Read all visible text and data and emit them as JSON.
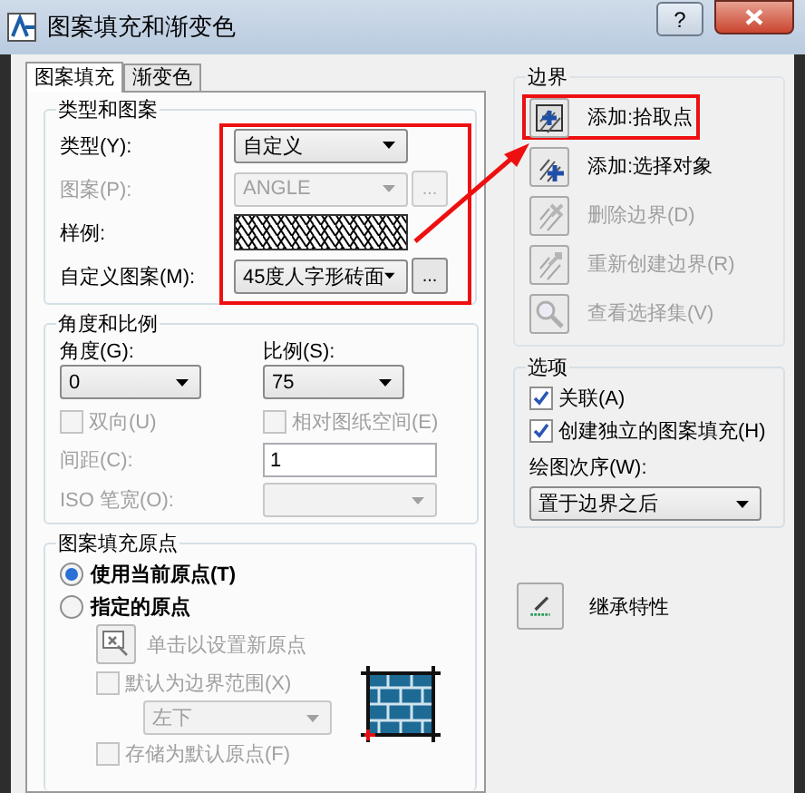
{
  "window": {
    "title": "图案填充和渐变色",
    "help": "?"
  },
  "tabs": [
    {
      "label": "图案填充",
      "selected": true
    },
    {
      "label": "渐变色",
      "selected": false
    }
  ],
  "type_and_pattern": {
    "title": "类型和图案",
    "highlighted": true,
    "fields": [
      {
        "kind": "dropdown",
        "label": "类型(Y):",
        "value": "自定义",
        "disabled": false
      },
      {
        "kind": "dropdown_browse",
        "label": "图案(P):",
        "value": "ANGLE",
        "browse": "...",
        "disabled": true
      },
      {
        "kind": "swatch",
        "label": "样例:",
        "disabled": false
      },
      {
        "kind": "dropdown_browse",
        "label": "自定义图案(M):",
        "value": "45度人字形砖面",
        "browse": "...",
        "disabled": false
      }
    ]
  },
  "angle_and_scale": {
    "title": "角度和比例",
    "angle": {
      "label": "角度(G):",
      "value": "0"
    },
    "scale": {
      "label": "比例(S):",
      "value": "75"
    },
    "checkboxes": [
      {
        "label": "双向(U)",
        "checked": false,
        "disabled": true
      },
      {
        "label": "相对图纸空间(E)",
        "checked": false,
        "disabled": true
      }
    ],
    "spacing": {
      "label": "间距(C):",
      "value": "1",
      "disabled": true
    },
    "iso_pen_width": {
      "label": "ISO 笔宽(O):",
      "disabled": true
    }
  },
  "hatch_origin": {
    "title": "图案填充原点",
    "radios": [
      {
        "label": "使用当前原点(T)",
        "selected": true
      },
      {
        "label": "指定的原点",
        "selected": false
      }
    ],
    "set_origin": {
      "label": "单击以设置新原点",
      "disabled": true
    },
    "default_extents": {
      "label": "默认为边界范围(X)",
      "checked": false,
      "disabled": true
    },
    "position": {
      "value": "左下",
      "disabled": true
    },
    "store_default": {
      "label": "存储为默认原点(F)",
      "checked": false,
      "disabled": true
    }
  },
  "boundaries": {
    "title": "边界",
    "buttons": [
      {
        "kind": "pick",
        "label": "添加:拾取点",
        "disabled": false,
        "highlighted": true
      },
      {
        "kind": "select",
        "label": "添加:选择对象",
        "disabled": false,
        "highlighted": false
      },
      {
        "kind": "remove",
        "label": "删除边界(D)",
        "disabled": true,
        "highlighted": false
      },
      {
        "kind": "recreate",
        "label": "重新创建边界(R)",
        "disabled": true,
        "highlighted": false
      },
      {
        "kind": "view",
        "label": "查看选择集(V)",
        "disabled": true,
        "highlighted": false
      }
    ]
  },
  "options": {
    "title": "选项",
    "checkboxes": [
      {
        "label": "关联(A)",
        "checked": true,
        "disabled": false
      },
      {
        "label": "创建独立的图案填充(H)",
        "checked": true,
        "disabled": false
      }
    ],
    "draw_order": {
      "label": "绘图次序(W):",
      "value": "置于边界之后"
    }
  },
  "inherit": {
    "label": "继承特性"
  },
  "callout": {
    "visible": true
  }
}
